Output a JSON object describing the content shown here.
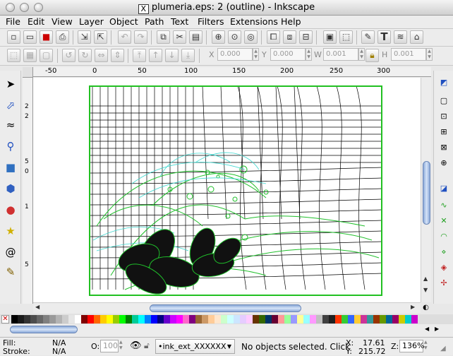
{
  "window": {
    "title": "plumeria.eps: 2 (outline) - Inkscape",
    "app_glyph": "X"
  },
  "menu": [
    "File",
    "Edit",
    "View",
    "Layer",
    "Object",
    "Path",
    "Text",
    "Filters",
    "Extensions",
    "Help"
  ],
  "toolbar_controls": {
    "x_label": "X",
    "x_value": "0.000",
    "y_label": "Y",
    "y_value": "0.000",
    "w_label": "W",
    "w_value": "0.001",
    "h_label": "H",
    "h_value": "0.001"
  },
  "ruler": {
    "h_ticks": [
      "-50",
      "0",
      "50",
      "100",
      "150",
      "200",
      "250",
      "300"
    ],
    "v_ticks": [
      "2",
      "2",
      "5",
      "0",
      "1",
      "5"
    ]
  },
  "status": {
    "fill_label": "Fill:",
    "fill_value": "N/A",
    "stroke_label": "Stroke:",
    "stroke_value": "N/A",
    "opacity_label": "O:",
    "opacity_value": "100",
    "layer": "•ink_ext_XXXXXX",
    "message": "No objects selected. Click",
    "x_label": "X:",
    "x_value": "17.61",
    "y_label": "Y:",
    "y_value": "215.72",
    "zoom_label": "Z:",
    "zoom_value": "136%"
  },
  "palette_colors": [
    "#000000",
    "#1a1a1a",
    "#333333",
    "#4d4d4d",
    "#666666",
    "#808080",
    "#999999",
    "#b3b3b3",
    "#cccccc",
    "#e6e6e6",
    "#ffffff",
    "#800000",
    "#ff0000",
    "#ff6600",
    "#ffcc00",
    "#ffff00",
    "#99cc00",
    "#00ff00",
    "#008000",
    "#00cc99",
    "#00ffff",
    "#0080ff",
    "#0000ff",
    "#000080",
    "#6600cc",
    "#cc00ff",
    "#ff00ff",
    "#ff66cc",
    "#800080",
    "#996633",
    "#cc9966",
    "#ffcc99",
    "#ffe6cc",
    "#ccffcc",
    "#ccffff",
    "#cce6ff",
    "#e6ccff",
    "#ffccff",
    "#663300",
    "#336600",
    "#003366",
    "#660033",
    "#ff9999",
    "#99ff99",
    "#9999ff",
    "#ffff99",
    "#99ffff",
    "#ff99ff",
    "#c0c0c0",
    "#404040",
    "#202020",
    "#ff3300",
    "#33cc33",
    "#3366ff",
    "#ffcc33",
    "#cc3399",
    "#339999",
    "#993300",
    "#669900",
    "#006699",
    "#990066",
    "#cccc00",
    "#00cccc",
    "#cc00cc"
  ],
  "colors": {
    "page_border": "#22c022",
    "outline_green": "#1fbf2a",
    "outline_cyan": "#3fd8d0",
    "outline_black": "#000000"
  }
}
